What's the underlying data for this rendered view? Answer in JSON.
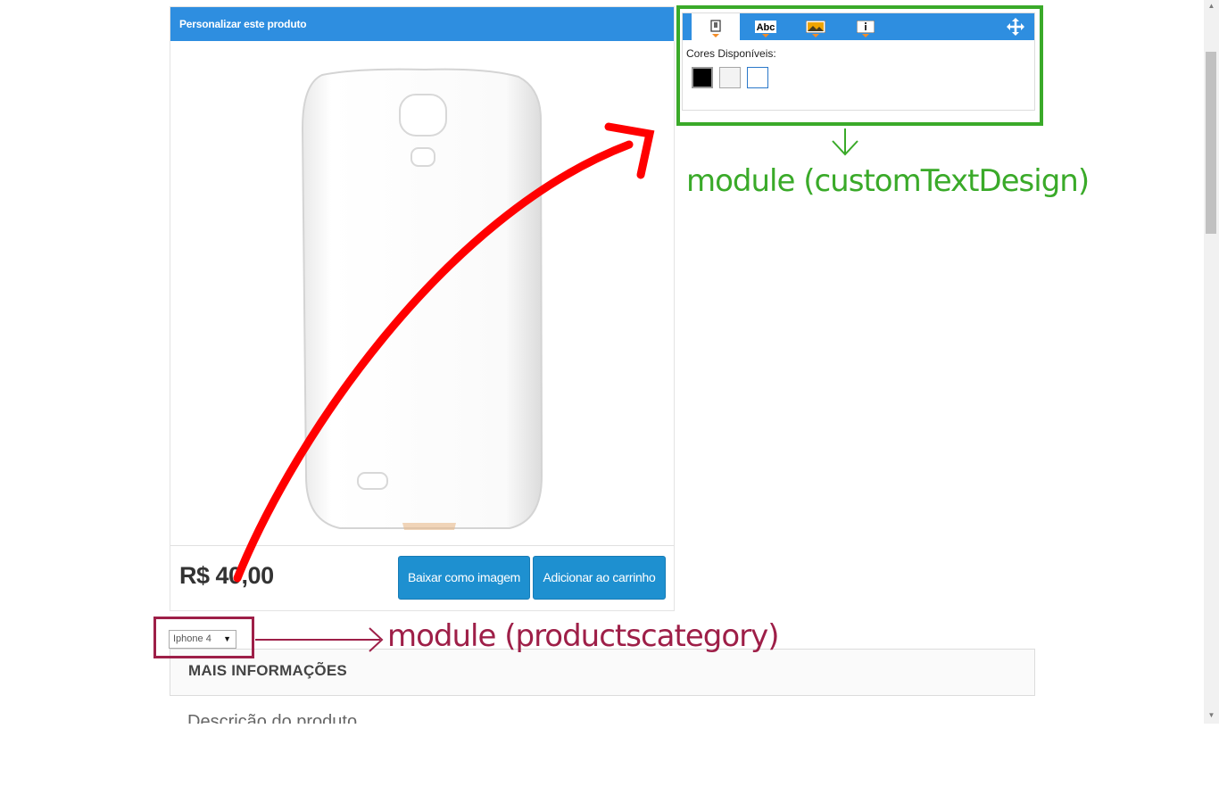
{
  "product_panel": {
    "header_title": "Personalizar este produto",
    "price": "R$ 40,00",
    "download_button": "Baixar como imagem",
    "cart_button": "Adicionar ao carrinho"
  },
  "customizer": {
    "tools": [
      {
        "name": "product-tool",
        "icon": "phone-icon",
        "active": true
      },
      {
        "name": "text-tool",
        "icon": "abc-text-icon",
        "label": "Abc",
        "active": false
      },
      {
        "name": "image-tool",
        "icon": "image-icon",
        "active": false
      },
      {
        "name": "info-tool",
        "icon": "info-icon",
        "active": false
      }
    ],
    "colors_label": "Cores Disponíveis:",
    "swatches": [
      "#000000",
      "#f3f3f3",
      "#ffffff"
    ],
    "accent_color": "#2e8ee0"
  },
  "annotations": {
    "custom_text_design": "module (customTextDesign)",
    "products_category": "module (productscategory)",
    "green": "#3aaa29",
    "maroon": "#9e1f48",
    "red": "#ff0000"
  },
  "product_select": {
    "selected": "Iphone 4"
  },
  "more_info": {
    "title": "MAIS INFORMAÇÕES",
    "description_heading": "Descrição do produto"
  }
}
